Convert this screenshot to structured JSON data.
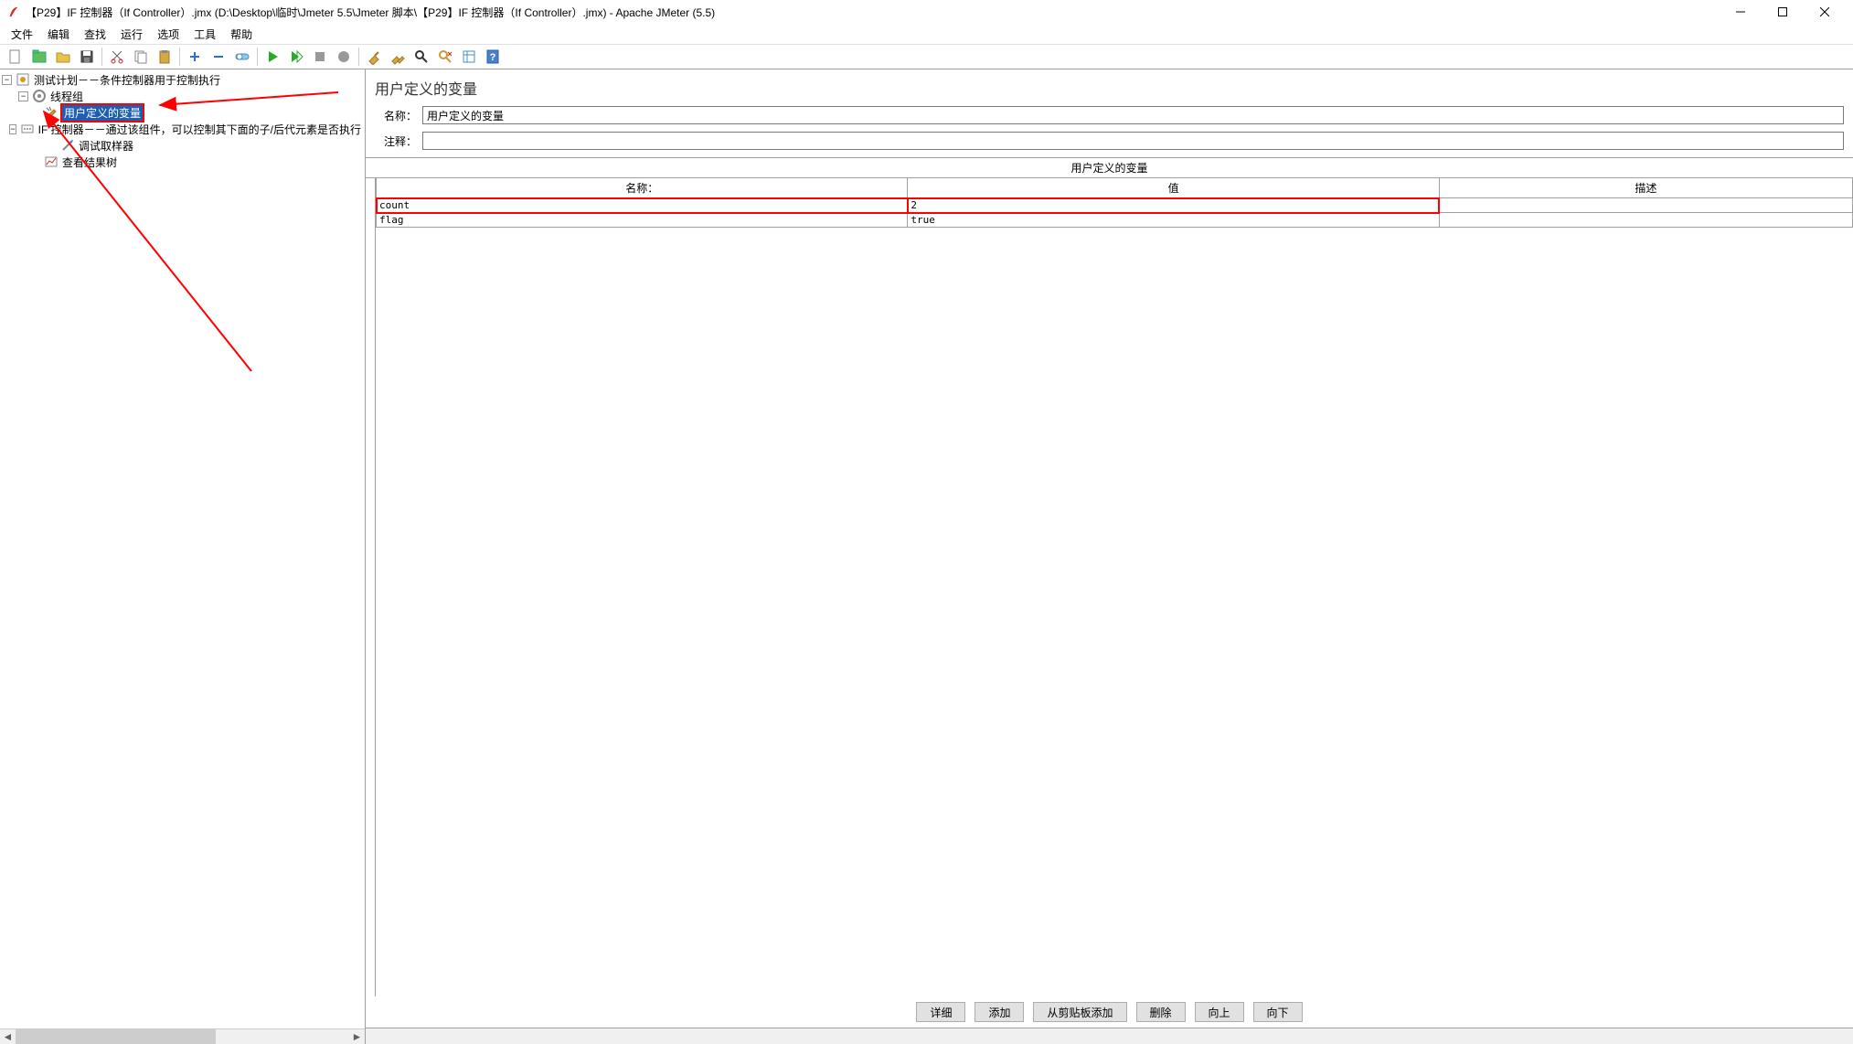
{
  "window": {
    "title": "【P29】IF 控制器（If Controller）.jmx (D:\\Desktop\\临时\\Jmeter 5.5\\Jmeter 脚本\\【P29】IF 控制器（If Controller）.jmx) - Apache JMeter (5.5)"
  },
  "menu": {
    "file": "文件",
    "edit": "编辑",
    "search": "查找",
    "run": "运行",
    "options": "选项",
    "tools": "工具",
    "help": "帮助"
  },
  "tree": {
    "root": "测试计划－－条件控制器用于控制执行",
    "thread_group": "线程组",
    "udv": "用户定义的变量",
    "if_controller": "IF 控制器－－通过该组件，可以控制其下面的子/后代元素是否执行",
    "debug_sampler": "调试取样器",
    "view_results": "查看结果树"
  },
  "panel": {
    "title": "用户定义的变量",
    "name_label": "名称：",
    "name_value": "用户定义的变量",
    "comment_label": "注释：",
    "comment_value": "",
    "section": "用户定义的变量"
  },
  "table": {
    "cols": {
      "name": "名称：",
      "value": "值",
      "desc": "描述"
    },
    "rows": [
      {
        "name": "count",
        "value": "2",
        "desc": ""
      },
      {
        "name": "flag",
        "value": "true",
        "desc": ""
      }
    ]
  },
  "buttons": {
    "detail": "详细",
    "add": "添加",
    "clipboard": "从剪贴板添加",
    "delete": "删除",
    "up": "向上",
    "down": "向下"
  }
}
